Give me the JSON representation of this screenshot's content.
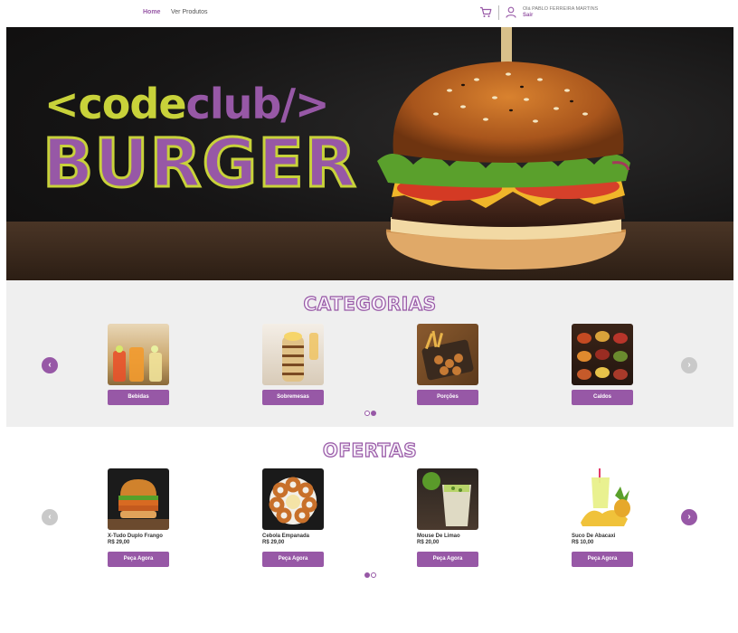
{
  "header": {
    "nav": [
      {
        "label": "Home",
        "active": true
      },
      {
        "label": "Ver Produtos",
        "active": false
      }
    ],
    "cart_icon": "cart-icon",
    "user_icon": "user-icon",
    "greeting": "Olá PABLO FERREIRA MARTINS",
    "logout_label": "Sair"
  },
  "banner": {
    "brand_open": "<code",
    "brand_club": "club/>",
    "brand_burger": "BURGER",
    "colors": {
      "lime": "#c8d23a",
      "purple": "#9758a6"
    }
  },
  "categories": {
    "title": "CATEGORIAS",
    "items": [
      {
        "label": "Bebidas"
      },
      {
        "label": "Sobremesas"
      },
      {
        "label": "Porções"
      },
      {
        "label": "Caldos"
      }
    ],
    "prev_icon": "chevron-left-icon",
    "next_icon": "chevron-right-icon"
  },
  "offers": {
    "title": "OFERTAS",
    "items": [
      {
        "name": "X-Tudo Duplo Frango",
        "price": "R$ 29,00",
        "button": "Peça Agora"
      },
      {
        "name": "Cebola Empanada",
        "price": "R$ 29,00",
        "button": "Peça Agora"
      },
      {
        "name": "Mouse De Limao",
        "price": "R$ 20,00",
        "button": "Peça Agora"
      },
      {
        "name": "Suco De Abacaxi",
        "price": "R$ 10,00",
        "button": "Peça Agora"
      }
    ]
  },
  "theme": {
    "accent": "#9758a6",
    "section_bg": "#efefef"
  }
}
